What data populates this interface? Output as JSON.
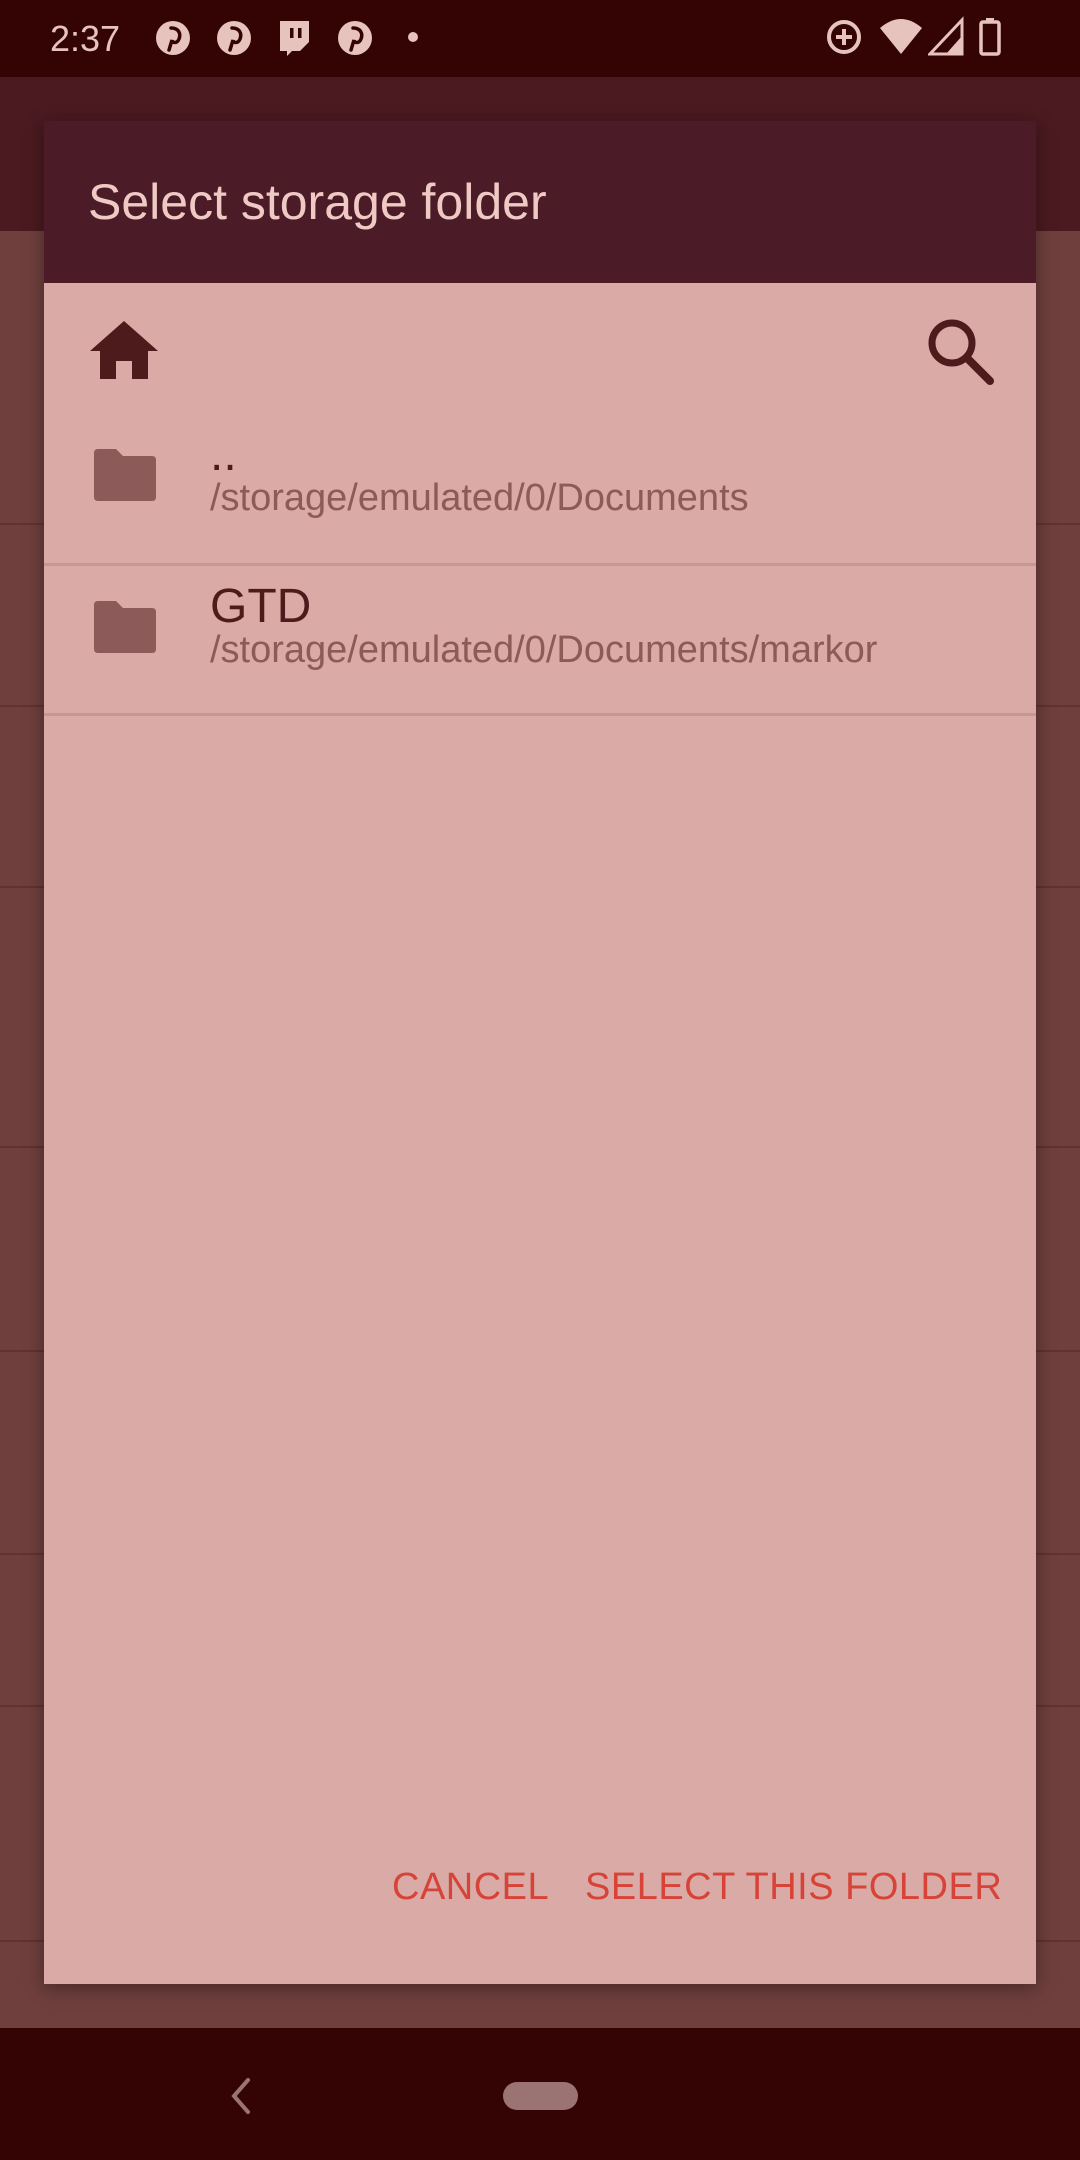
{
  "status_bar": {
    "time": "2:37",
    "notification_icons": [
      "pinterest-icon",
      "pinterest-icon",
      "twitch-icon",
      "pinterest-icon",
      "dot-icon"
    ],
    "system_icons": [
      "data-saver-icon",
      "wifi-icon",
      "signal-icon",
      "battery-icon"
    ]
  },
  "dialog": {
    "title": "Select storage folder",
    "toolbar": {
      "home_icon": "home-icon",
      "search_icon": "search-icon"
    },
    "items": [
      {
        "name": "..",
        "path": "/storage/emulated/0/Documents",
        "icon": "folder-icon"
      },
      {
        "name": "GTD",
        "path": "/storage/emulated/0/Documents/markor",
        "icon": "folder-icon"
      }
    ],
    "buttons": {
      "cancel": "CANCEL",
      "select": "SELECT THIS FOLDER"
    }
  },
  "colors": {
    "dialog_header": "#4b1c27",
    "dialog_body": "#d9aaa6",
    "accent": "#d84338",
    "status_bar": "#340404"
  }
}
